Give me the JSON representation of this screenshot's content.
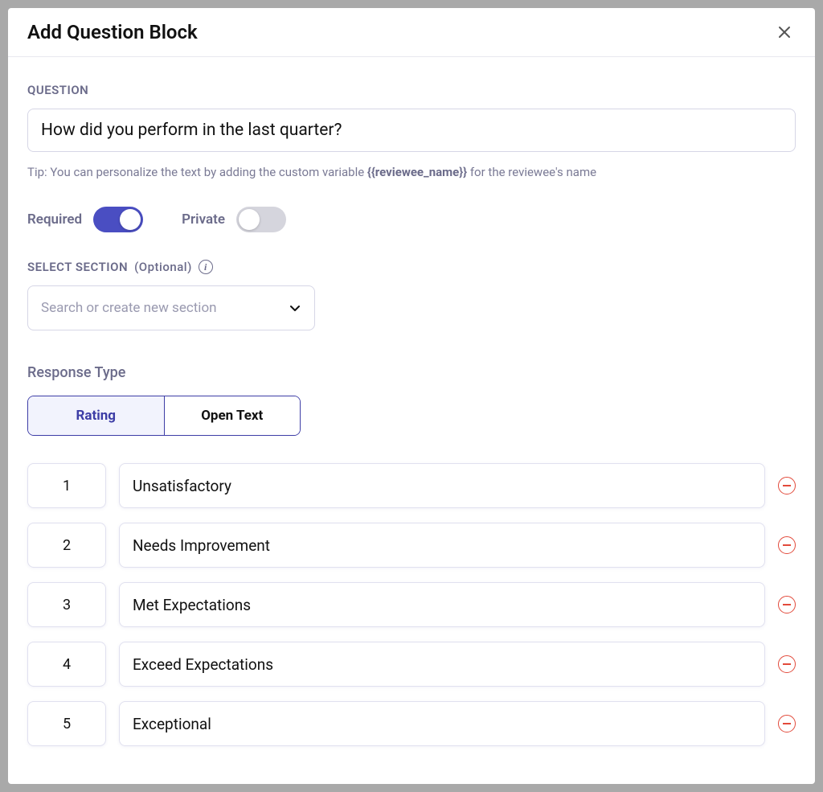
{
  "modal": {
    "title": "Add Question Block"
  },
  "question": {
    "label": "QUESTION",
    "value": "How did you perform in the last quarter?",
    "tip_prefix": "Tip: You can personalize the text by adding the custom variable ",
    "tip_variable": "{{reviewee_name}}",
    "tip_suffix": " for the reviewee's name"
  },
  "toggles": {
    "required_label": "Required",
    "required_on": true,
    "private_label": "Private",
    "private_on": false
  },
  "section": {
    "label": "SELECT SECTION",
    "optional": "(Optional)",
    "placeholder": "Search or create new section"
  },
  "response": {
    "label": "Response Type",
    "tab_rating": "Rating",
    "tab_open_text": "Open Text"
  },
  "ratings": [
    {
      "num": "1",
      "label": "Unsatisfactory"
    },
    {
      "num": "2",
      "label": "Needs Improvement"
    },
    {
      "num": "3",
      "label": "Met Expectations"
    },
    {
      "num": "4",
      "label": "Exceed Expectations"
    },
    {
      "num": "5",
      "label": "Exceptional"
    }
  ]
}
